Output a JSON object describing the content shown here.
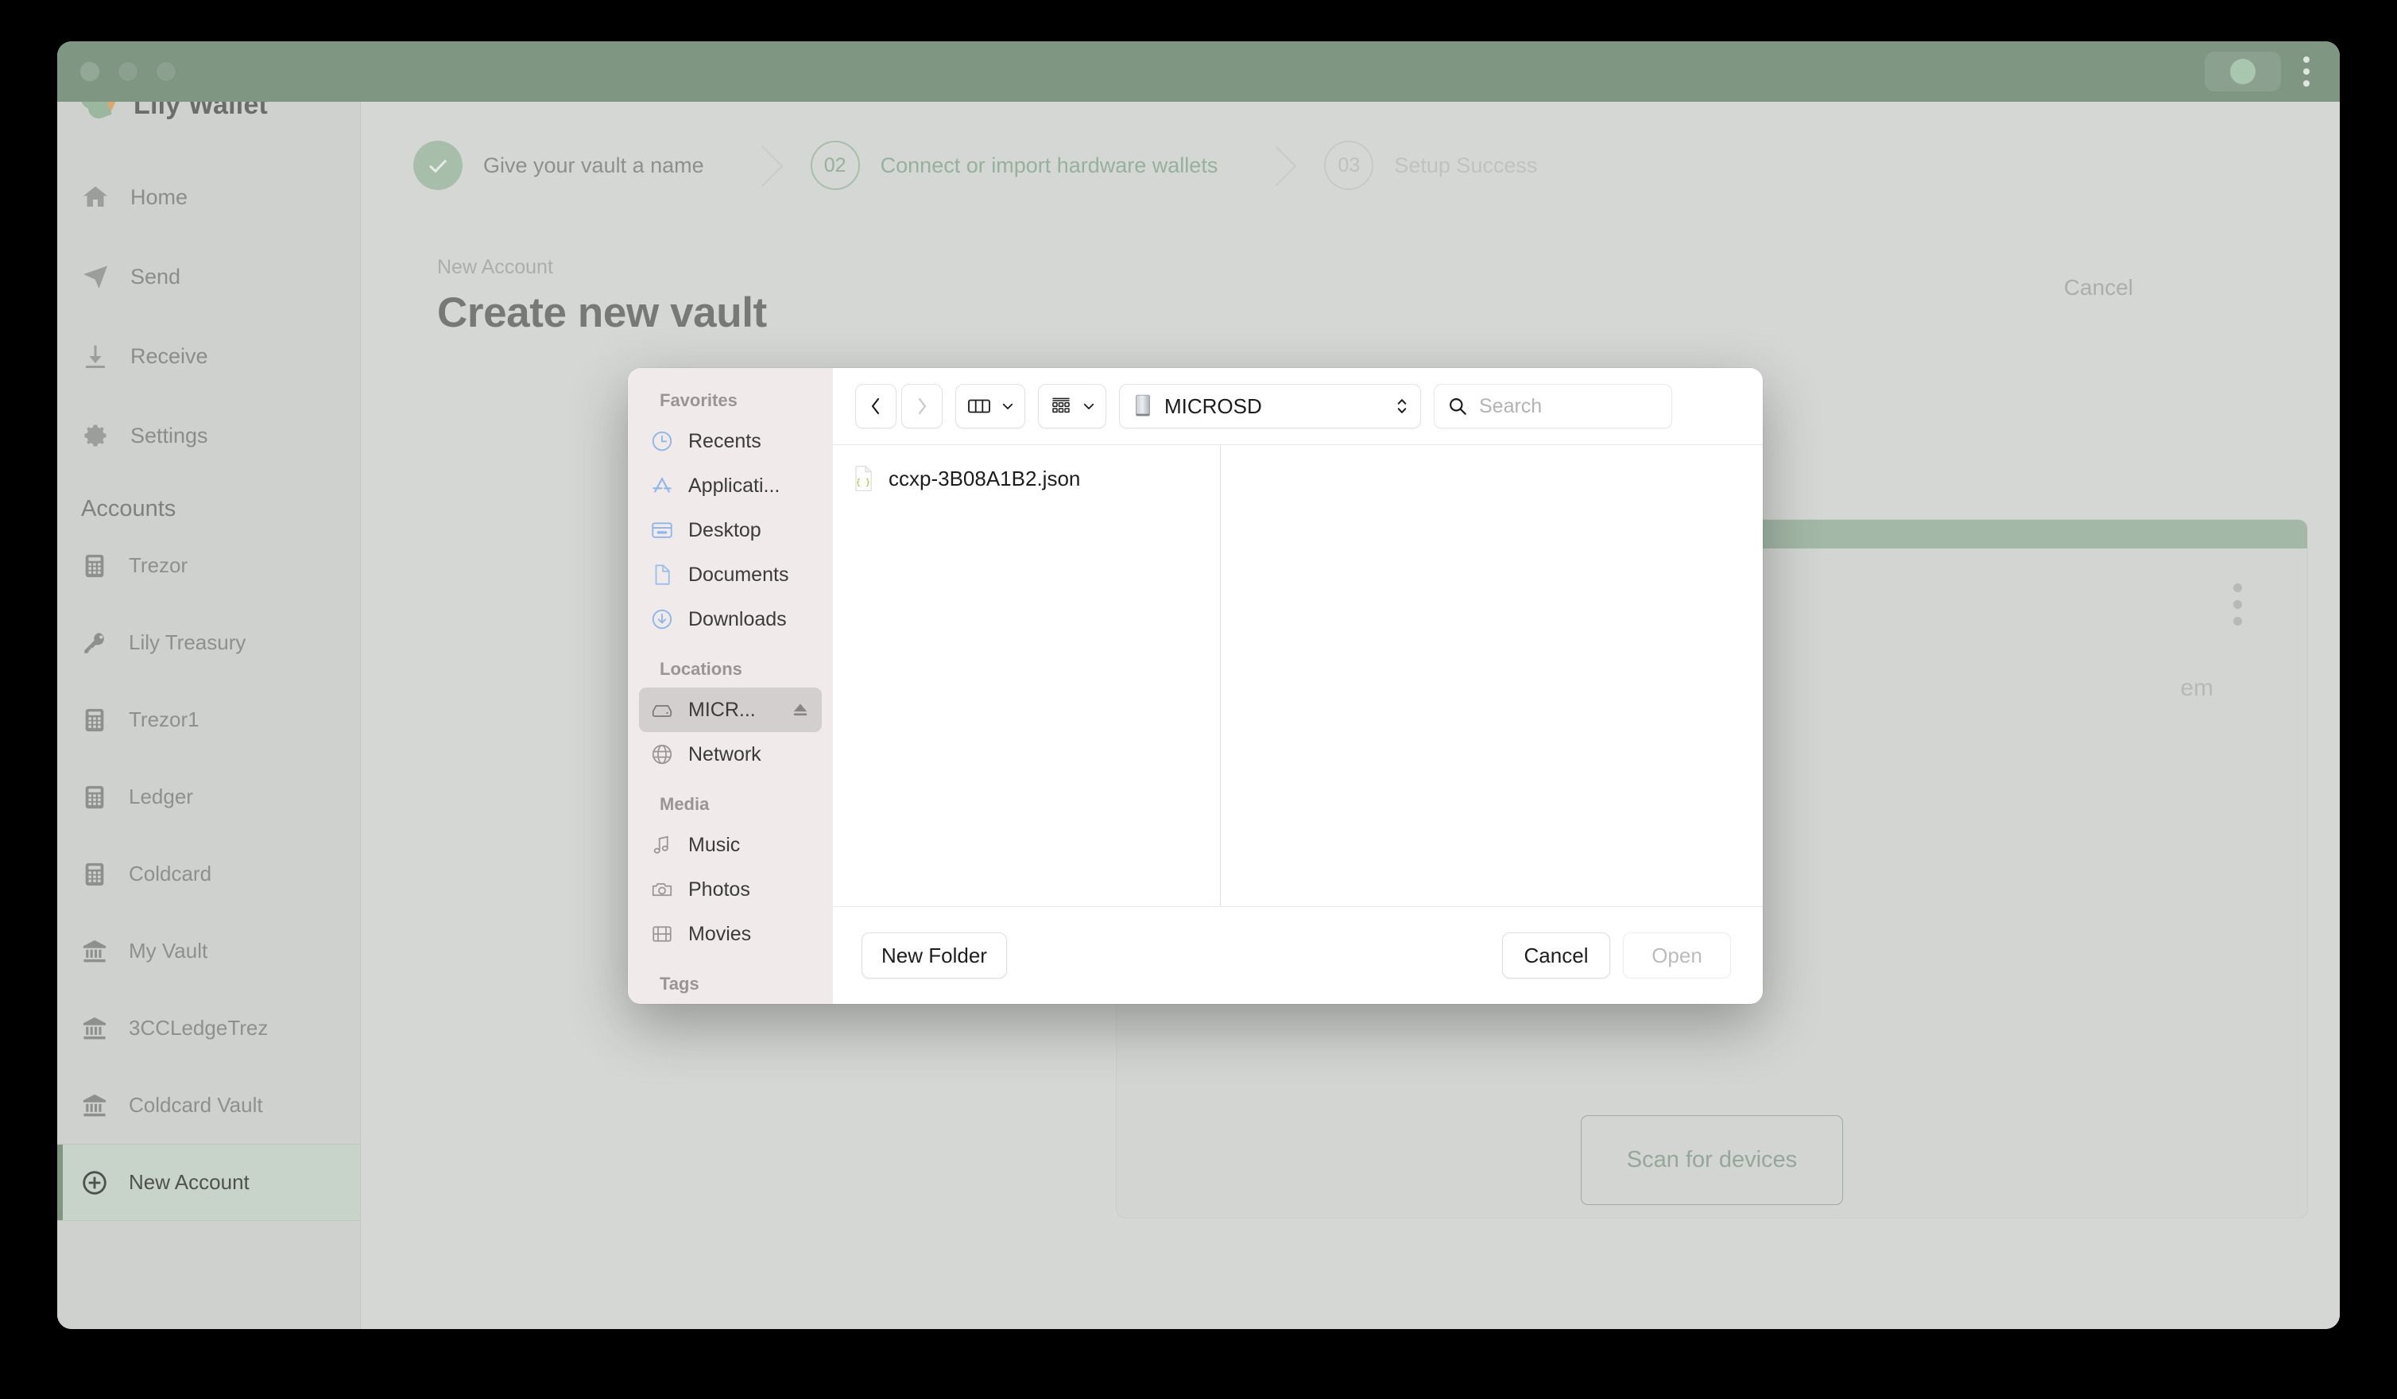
{
  "window": {
    "traffic_lights": [
      "close",
      "minimize",
      "maximize"
    ],
    "titlebar_menu_icon": "kebab-menu-icon",
    "status_indicator_icon": "status-dot-icon",
    "accent_green": "#7f9683",
    "app_chrome_gray": "#d5d7d5"
  },
  "sidebar": {
    "brand": "Lily Wallet",
    "nav": [
      {
        "label": "Home",
        "icon": "home-icon"
      },
      {
        "label": "Send",
        "icon": "send-icon"
      },
      {
        "label": "Receive",
        "icon": "receive-icon"
      },
      {
        "label": "Settings",
        "icon": "gear-icon"
      }
    ],
    "accounts_heading": "Accounts",
    "accounts": [
      {
        "label": "Trezor",
        "icon": "hardware-wallet-icon",
        "active": false
      },
      {
        "label": "Lily Treasury",
        "icon": "key-icon",
        "active": false
      },
      {
        "label": "Trezor1",
        "icon": "hardware-wallet-icon",
        "active": false
      },
      {
        "label": "Ledger",
        "icon": "hardware-wallet-icon",
        "active": false
      },
      {
        "label": "Coldcard",
        "icon": "hardware-wallet-icon",
        "active": false
      },
      {
        "label": "My Vault",
        "icon": "vault-bank-icon",
        "active": false
      },
      {
        "label": "3CCLedgeTrez",
        "icon": "vault-bank-icon",
        "active": false
      },
      {
        "label": "Coldcard Vault",
        "icon": "vault-bank-icon",
        "active": false
      },
      {
        "label": "New Account",
        "icon": "plus-circle-icon",
        "active": true
      }
    ]
  },
  "stepper": {
    "steps": [
      {
        "num": "01",
        "label": "Give your vault a name",
        "state": "done",
        "icon": "check-icon"
      },
      {
        "num": "02",
        "label": "Connect or import hardware wallets",
        "state": "current"
      },
      {
        "num": "03",
        "label": "Setup Success",
        "state": "todo"
      }
    ]
  },
  "page": {
    "breadcrumb": "New Account",
    "title": "Create new vault",
    "cancel_label": "Cancel",
    "card_text": "em",
    "card_menu_icon": "kebab-menu-icon",
    "scan_button": "Scan for devices"
  },
  "dialog": {
    "sections": [
      {
        "heading": "Favorites",
        "items": [
          {
            "label": "Recents",
            "icon": "clock-icon",
            "selected": false
          },
          {
            "label": "Applicati...",
            "icon": "applications-icon",
            "selected": false
          },
          {
            "label": "Desktop",
            "icon": "desktop-icon",
            "selected": false
          },
          {
            "label": "Documents",
            "icon": "document-icon",
            "selected": false
          },
          {
            "label": "Downloads",
            "icon": "download-circle-icon",
            "selected": false
          }
        ]
      },
      {
        "heading": "Locations",
        "items": [
          {
            "label": "MICR...",
            "icon": "external-drive-icon",
            "selected": true,
            "eject": true
          },
          {
            "label": "Network",
            "icon": "globe-icon",
            "selected": false
          }
        ]
      },
      {
        "heading": "Media",
        "items": [
          {
            "label": "Music",
            "icon": "music-note-icon",
            "selected": false
          },
          {
            "label": "Photos",
            "icon": "camera-icon",
            "selected": false
          },
          {
            "label": "Movies",
            "icon": "film-icon",
            "selected": false
          }
        ]
      },
      {
        "heading": "Tags",
        "items": []
      }
    ],
    "toolbar": {
      "back_icon": "chevron-left-icon",
      "forward_icon": "chevron-right-icon",
      "view_icon": "column-view-icon",
      "view_chevron_icon": "chevron-down-icon",
      "group_icon": "group-by-icon",
      "group_chevron_icon": "chevron-down-icon",
      "path_icon": "external-drive-icon",
      "path_label": "MICROSD",
      "path_stepper_icon": "updown-chevrons-icon",
      "search_icon": "search-icon",
      "search_placeholder": "Search",
      "search_value": ""
    },
    "files": [
      {
        "name": "ccxp-3B08A1B2.json",
        "icon": "json-file-icon"
      }
    ],
    "footer": {
      "new_folder_label": "New Folder",
      "cancel_label": "Cancel",
      "open_label": "Open",
      "open_disabled": true
    }
  }
}
